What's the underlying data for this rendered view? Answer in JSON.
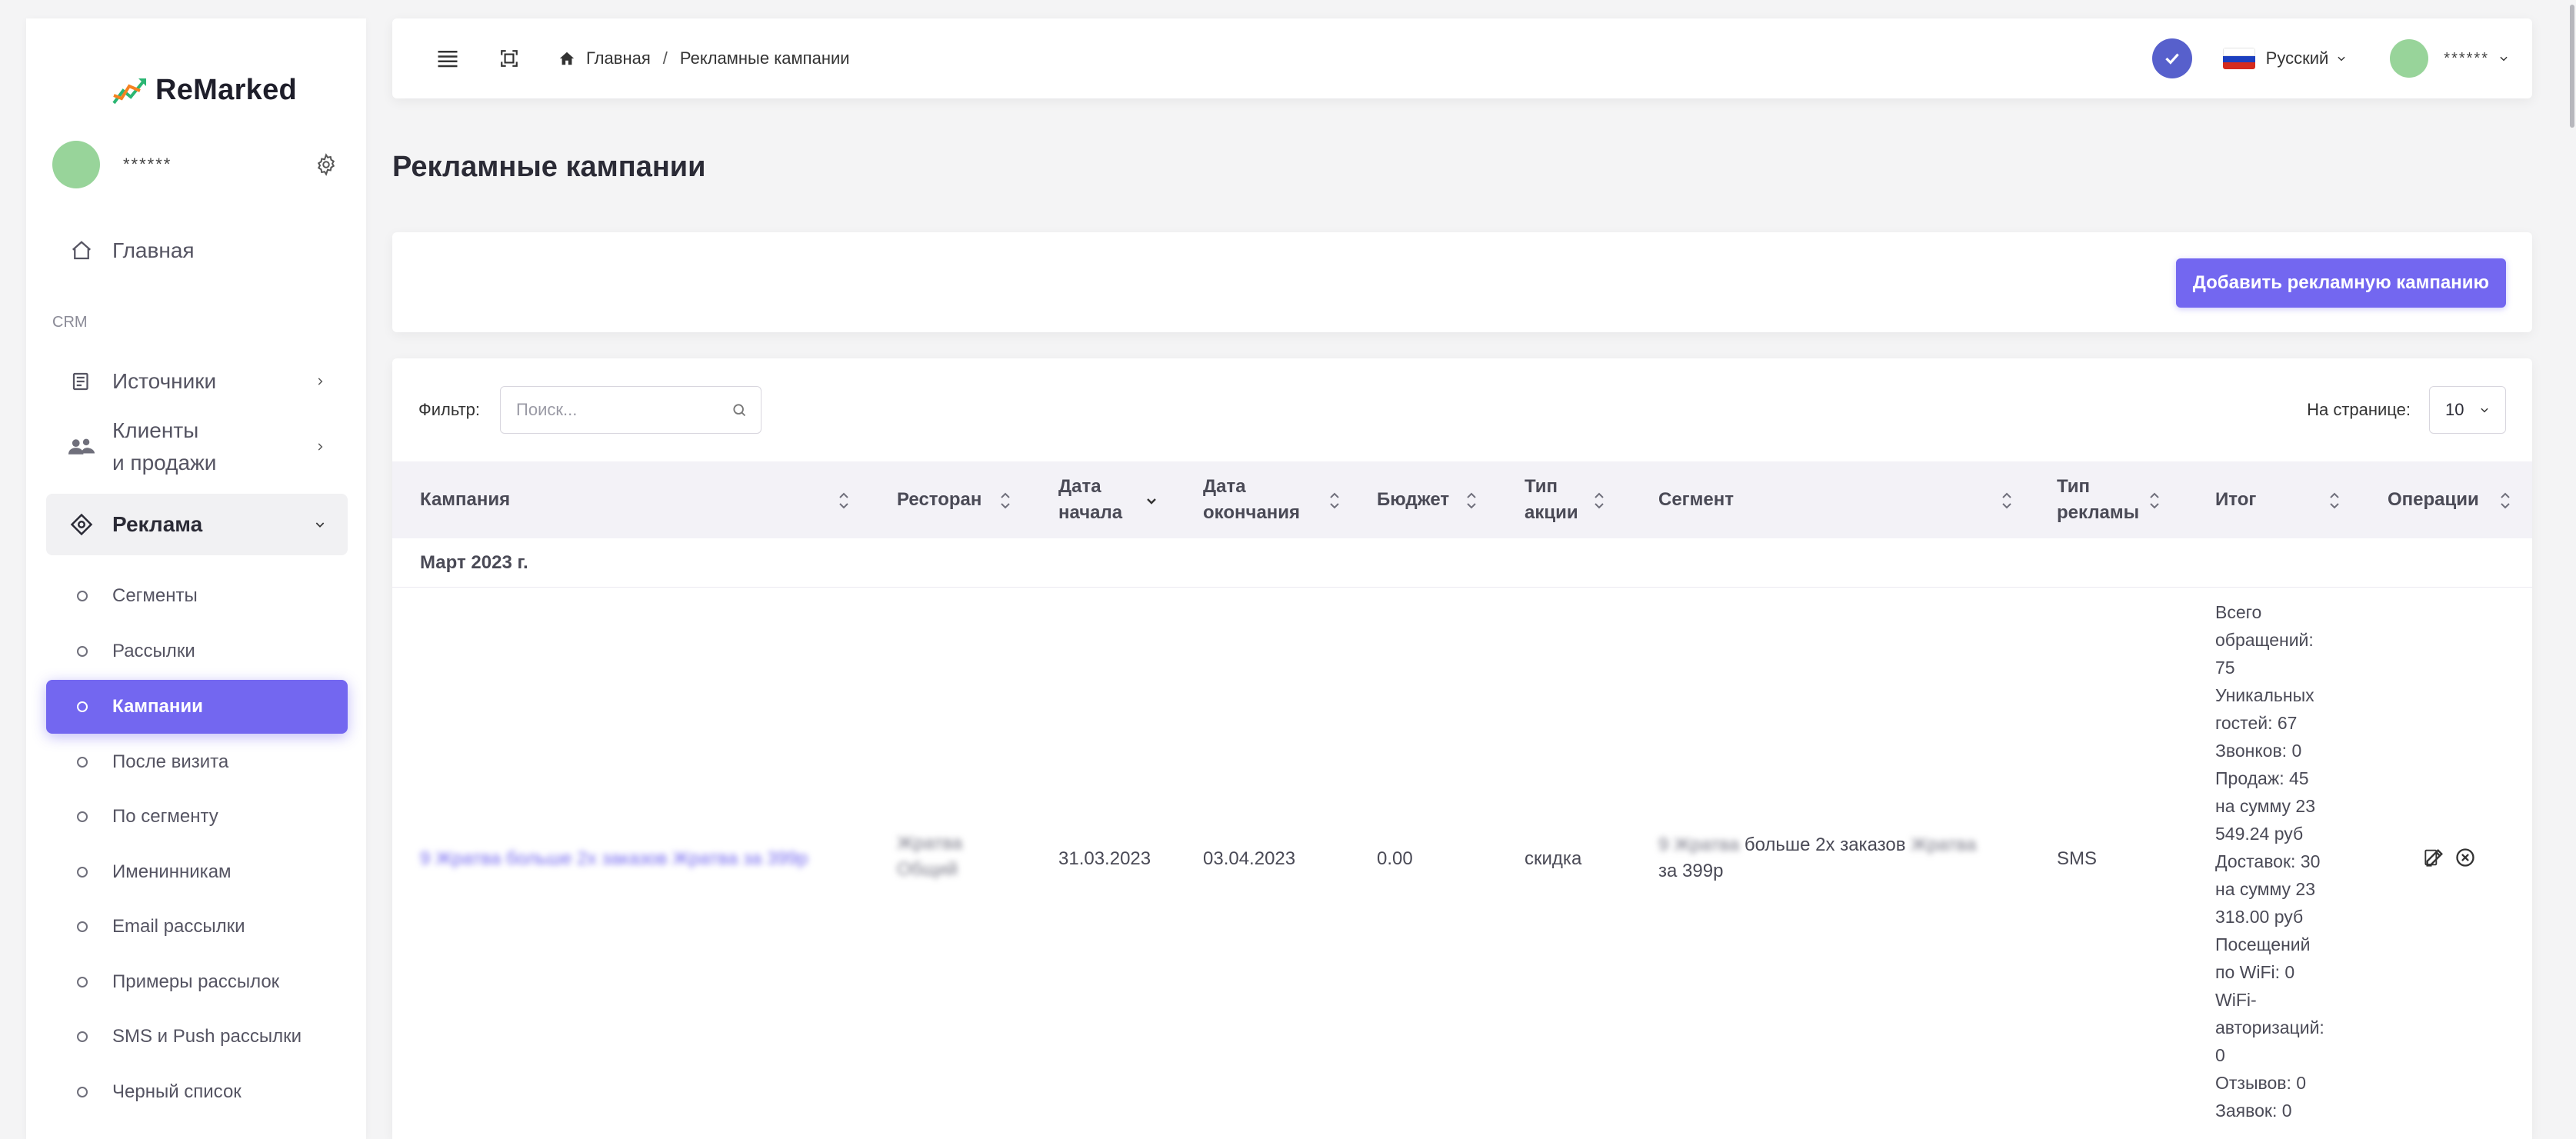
{
  "sidebar": {
    "logo_text": "ReMarked",
    "user_name": "******",
    "main_item": "Главная",
    "section_label": "CRM",
    "items": [
      {
        "label": "Источники"
      },
      {
        "label_line1": "Клиенты",
        "label_line2": "и продажи"
      },
      {
        "label": "Реклама"
      }
    ],
    "sub_items": [
      "Сегменты",
      "Рассылки",
      "Кампании",
      "После визита",
      "По сегменту",
      "Именинникам",
      "Email рассылки",
      "Примеры рассылок",
      "SMS и Push рассылки",
      "Черный список"
    ]
  },
  "navbar": {
    "breadcrumb_home": "Главная",
    "breadcrumb_sep": "/",
    "breadcrumb_current": "Рекламные кампании",
    "language": "Русский",
    "user_name": "******"
  },
  "page": {
    "title": "Рекламные кампании",
    "add_button": "Добавить рекламную кампанию"
  },
  "filter": {
    "label": "Фильтр:",
    "placeholder": "Поиск...",
    "per_page_label": "На странице:",
    "per_page_value": "10"
  },
  "table": {
    "headers": {
      "campaign": "Кампания",
      "restaurant": "Ресторан",
      "start_1": "Дата",
      "start_2": "начала",
      "end_1": "Дата",
      "end_2": "окончания",
      "budget": "Бюджет",
      "action_1": "Тип",
      "action_2": "акции",
      "segment": "Сегмент",
      "adtype_1": "Тип",
      "adtype_2": "рекламы",
      "result": "Итог",
      "operations": "Операции"
    },
    "group": "Март 2023 г.",
    "row": {
      "campaign": "9 Жратва больше 2х заказов Жратва за 399р",
      "restaurant_1": "Жратва",
      "restaurant_2": "Общий",
      "start": "31.03.2023",
      "end": "03.04.2023",
      "budget": "0.00",
      "action_type": "скидка",
      "segment_pre": "9 Жратва",
      "segment_mid": " больше 2х заказов ",
      "segment_post": "Жратва",
      "segment_line2": "за 399р",
      "ad_type": "SMS",
      "result_lines": [
        "Всего",
        "обращений:",
        "75",
        "Уникальных",
        "гостей: 67",
        "Звонков: 0",
        "Продаж: 45",
        "на сумму 23",
        "549.24 руб",
        "Доставок: 30",
        "на сумму 23",
        "318.00 руб",
        "Посещений",
        "по WiFi: 0",
        "WiFi-",
        "авторизаций:",
        "0",
        "Отзывов: 0",
        "Заявок: 0"
      ]
    }
  },
  "colors": {
    "primary": "#7367f0",
    "badge": "#5760cc",
    "avatar": "#98d49a"
  }
}
